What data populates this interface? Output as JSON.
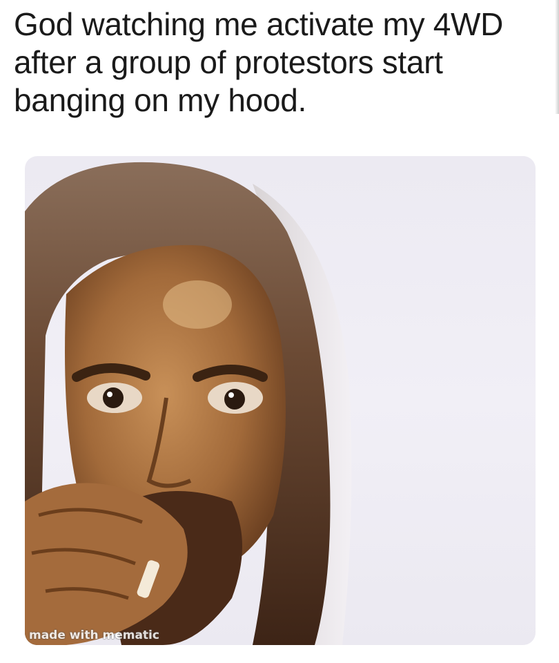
{
  "meme": {
    "caption": "God watching me activate my 4WD after a group of protestors start banging on my hood.",
    "watermark": "made with mematic"
  }
}
